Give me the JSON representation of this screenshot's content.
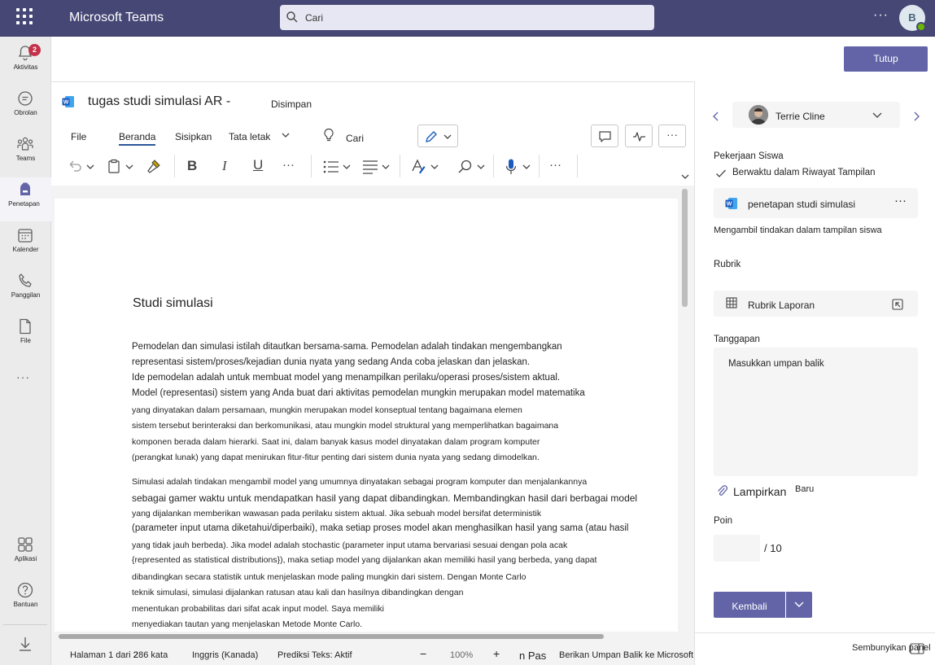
{
  "app": {
    "title": "Microsoft Teams"
  },
  "search": {
    "placeholder": "Cari"
  },
  "user": {
    "initial": "B"
  },
  "rail": {
    "items": [
      {
        "label": "Aktivitas",
        "badge": "2"
      },
      {
        "label": "Obrolan"
      },
      {
        "label": "Teams"
      },
      {
        "label": "Penetapan"
      },
      {
        "label": "Kalender"
      },
      {
        "label": "Panggilan"
      },
      {
        "label": "File"
      }
    ],
    "apps": "Aplikasi",
    "help": "Bantuan"
  },
  "header": {
    "close_label": "Tutup"
  },
  "word": {
    "doc_title": "tugas studi simulasi AR -",
    "saved": "Disimpan",
    "tabs": [
      "File",
      "Beranda",
      "Sisipkan",
      "Tata letak"
    ],
    "search": "Cari"
  },
  "document": {
    "heading": "Studi simulasi",
    "lines": [
      "Pemodelan dan simulasi istilah ditautkan bersama-sama. Pemodelan adalah tindakan mengembangkan",
      "representasi sistem/proses/kejadian dunia nyata yang sedang Anda coba jelaskan dan jelaskan.",
      "Ide pemodelan adalah untuk membuat model yang menampilkan perilaku/operasi proses/sistem aktual.",
      "Model (representasi) sistem yang Anda buat dari aktivitas pemodelan mungkin merupakan model matematika",
      "yang dinyatakan dalam persamaan, mungkin merupakan model konseptual tentang bagaimana elemen",
      "sistem tersebut berinteraksi dan berkomunikasi, atau mungkin model struktural yang memperlihatkan bagaimana",
      "komponen berada dalam hierarki. Saat ini, dalam banyak kasus model dinyatakan dalam program komputer",
      "(perangkat lunak) yang dapat menirukan fitur-fitur penting dari sistem dunia nyata yang sedang dimodelkan.",
      "Simulasi adalah tindakan mengambil model yang umumnya dinyatakan sebagai program komputer dan menjalankannya",
      "sebagai gamer waktu untuk mendapatkan hasil yang dapat dibandingkan. Membandingkan hasil dari berbagai model",
      "yang dijalankan memberikan wawasan pada perilaku sistem aktual. Jika sebuah model bersifat deterministik",
      "(parameter input utama diketahui/diperbaiki), maka setiap proses model akan menghasilkan hasil yang sama (atau hasil",
      "yang tidak jauh berbeda). Jika model adalah stochastic (parameter input utama bervariasi sesuai dengan pola acak",
      "{represented as statistical distributions}), maka setiap model yang dijalankan akan memiliki hasil yang berbeda, yang dapat",
      "dibandingkan secara statistik untuk menjelaskan mode paling mungkin dari sistem. Dengan Monte Carlo",
      "teknik simulasi, simulasi dijalankan ratusan atau kali dan hasilnya dibandingkan dengan",
      "menentukan probabilitas dari sifat acak input model. Saya memiliki",
      "menyediakan tautan yang menjelaskan Metode Monte Carlo."
    ]
  },
  "statusbar": {
    "page": "Halaman 1 dari 2",
    "words": "286 kata",
    "language": "Inggris (Kanada)",
    "prediction": "Prediksi Teks: Aktif",
    "zoom": "100%",
    "fit": "n Pas",
    "feedback": "Berikan Umpan Balik ke Microsoft"
  },
  "panel": {
    "student": "Terrie Cline",
    "work_label": "Pekerjaan Siswa",
    "on_time": "Berwaktu dalam Riwayat Tampilan",
    "file_name": "penetapan studi simulasi",
    "action_note": "Mengambil tindakan dalam tampilan siswa",
    "rubric_label": "Rubrik",
    "rubric_name": "Rubrik Laporan",
    "feedback_label": "Tanggapan",
    "feedback_placeholder": "Masukkan umpan balik",
    "attach": "Lampirkan",
    "new": "Baru",
    "points_label": "Poin",
    "points_max": "/ 10",
    "return_label": "Kembali",
    "hide_panel": "Sembunyikan panel"
  }
}
